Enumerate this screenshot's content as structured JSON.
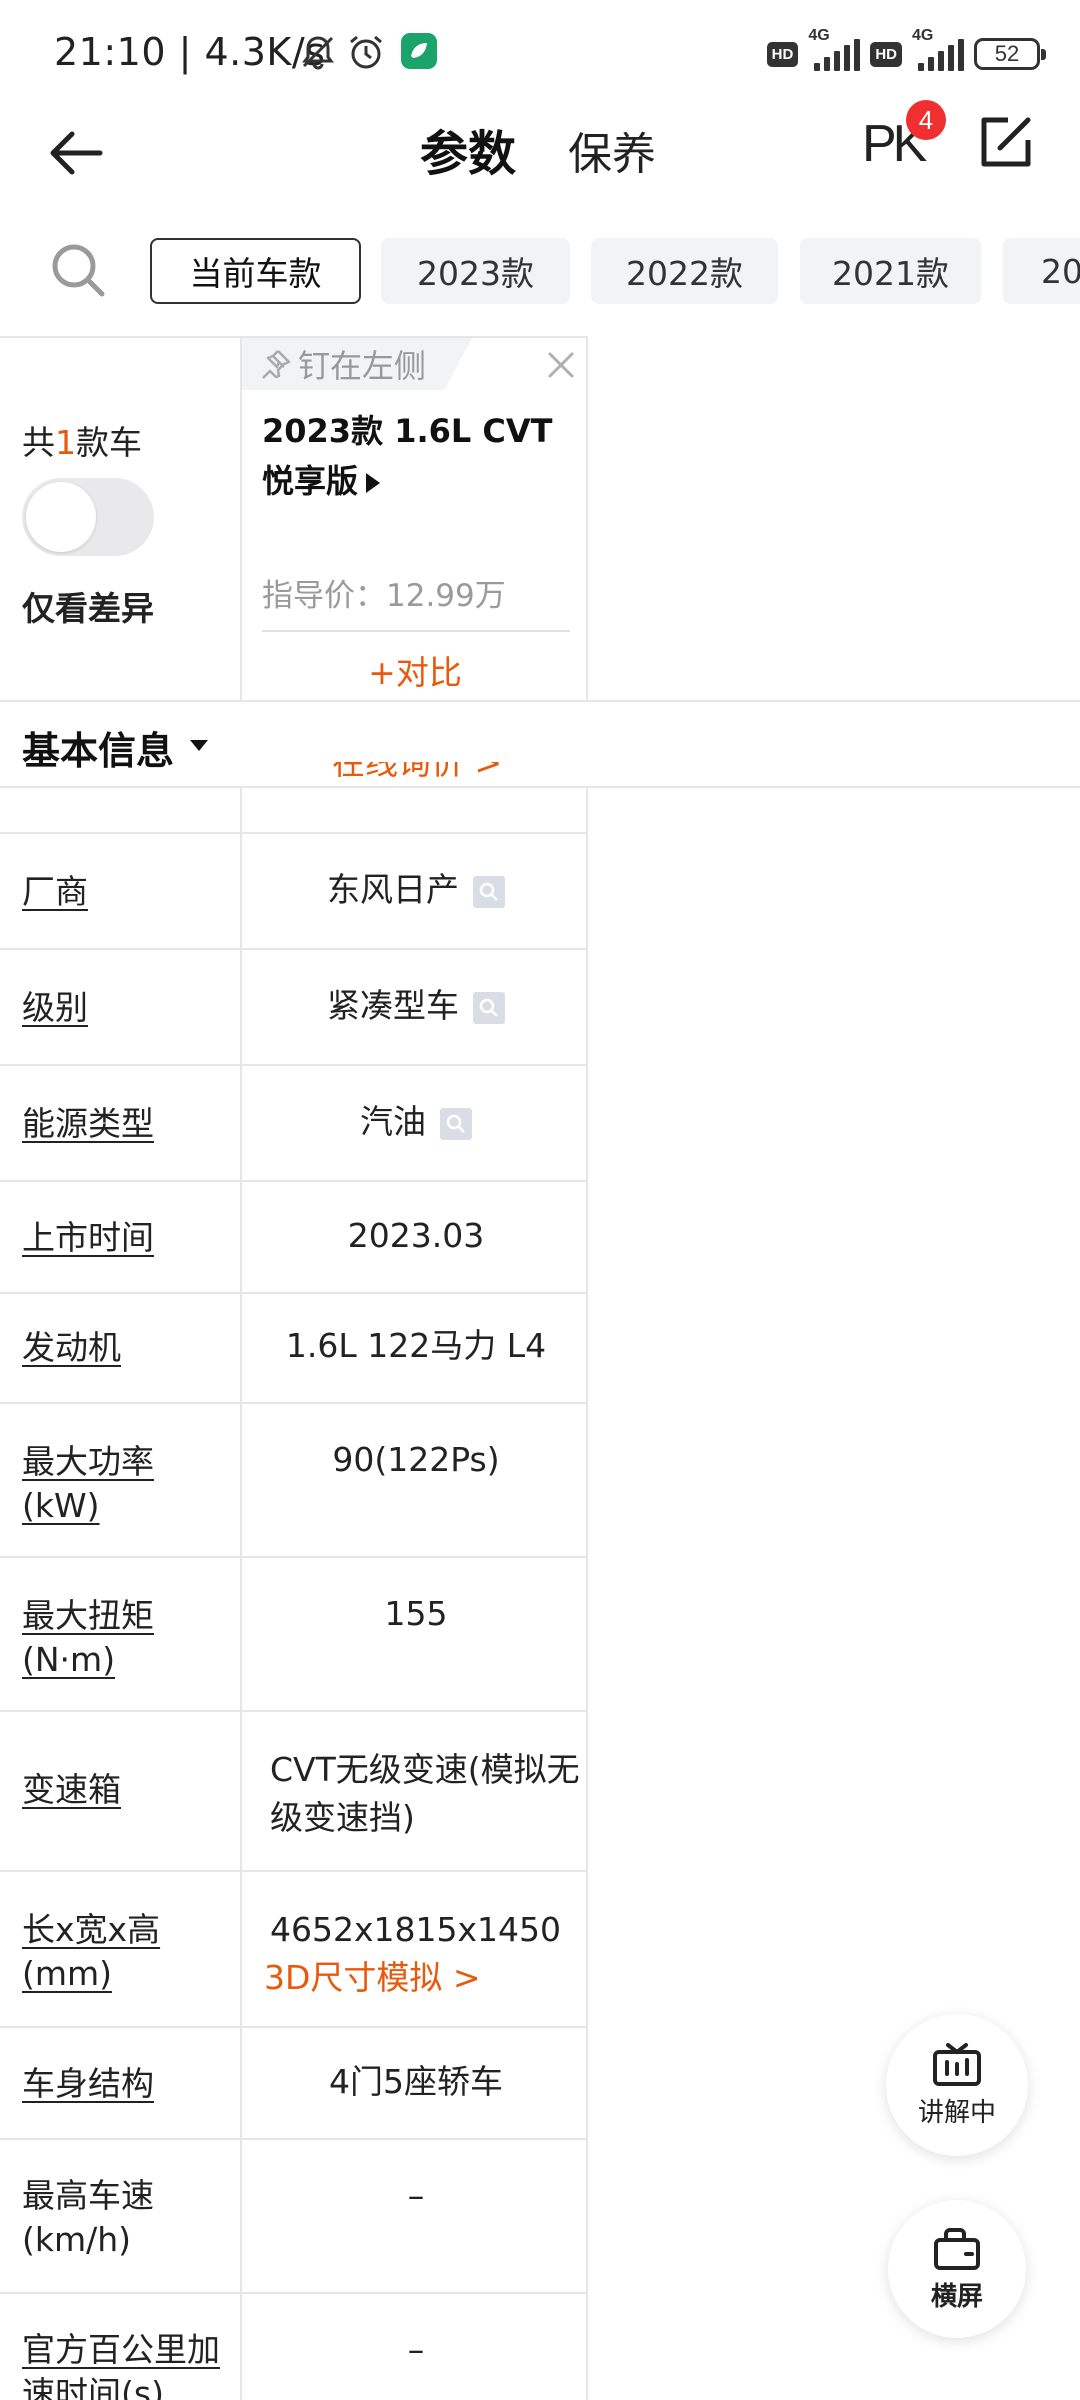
{
  "status_bar": {
    "time": "21:10 | 4.3K/s",
    "hd1": "HD",
    "net1": "4G",
    "hd2": "HD",
    "net2": "4G",
    "battery": "52"
  },
  "header": {
    "tab_params": "参数",
    "tab_maintenance": "保养",
    "pk_label": "PK",
    "pk_badge": "4"
  },
  "year_filter": {
    "chips": [
      "当前车款",
      "2023款",
      "2022款",
      "2021款",
      "20"
    ]
  },
  "left_panel": {
    "total_prefix": "共",
    "total_num": "1",
    "total_suffix": "款车",
    "diff_only": "仅看差异"
  },
  "car": {
    "pin_label": "钉在左侧",
    "name": "2023款 1.6L CVT悦享版",
    "price": "指导价：12.99万",
    "compare": "+对比"
  },
  "section": {
    "title": "基本信息"
  },
  "cut_link": "在线询价 >",
  "rows": [
    {
      "label": "厂商",
      "value": "东风日产"
    },
    {
      "label": "级别",
      "value": "紧凑型车"
    },
    {
      "label": "能源类型",
      "value": "汽油"
    },
    {
      "label": "上市时间",
      "value": "2023.03"
    },
    {
      "label": "发动机",
      "value": "1.6L 122马力 L4"
    },
    {
      "label": "最大功率(kW)",
      "value": "90(122Ps)"
    },
    {
      "label": "最大扭矩(N·m)",
      "value": "155"
    },
    {
      "label": "变速箱",
      "value": "CVT无级变速(模拟无级变速挡)"
    },
    {
      "label": "长x宽x高(mm)",
      "value": "4652x1815x1450",
      "link": "3D尺寸模拟 >"
    },
    {
      "label": "车身结构",
      "value": "4门5座轿车"
    },
    {
      "label": "最高车速(km/h)",
      "value": "–"
    },
    {
      "label": "官方百公里加速时间(s)",
      "value": "–"
    }
  ],
  "fab": {
    "explain": "讲解中",
    "landscape": "横屏"
  }
}
